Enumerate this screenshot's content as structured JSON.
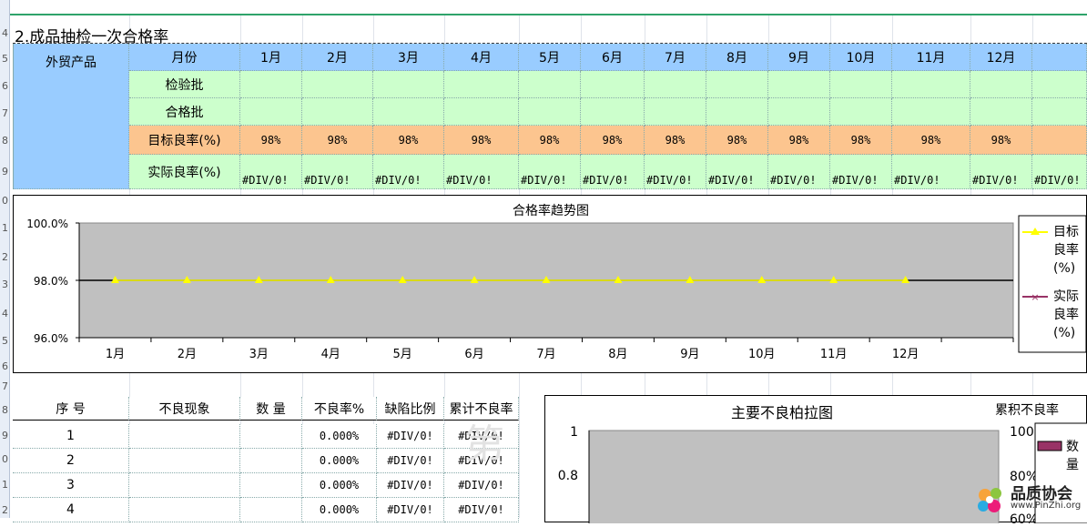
{
  "section_title": "2.成品抽检一次合格率",
  "table1": {
    "category": "外贸产品",
    "month_header": "月份",
    "months": [
      "1月",
      "2月",
      "3月",
      "4月",
      "5月",
      "6月",
      "7月",
      "8月",
      "9月",
      "10月",
      "11月",
      "12月"
    ],
    "row_labels": [
      "检验批",
      "合格批",
      "目标良率(%)",
      "实际良率(%)"
    ],
    "target_values": [
      "98%",
      "98%",
      "98%",
      "98%",
      "98%",
      "98%",
      "98%",
      "98%",
      "98%",
      "98%",
      "98%",
      "98%"
    ],
    "actual_values": [
      "#DIV/0!",
      "#DIV/0!",
      "#DIV/0!",
      "#DIV/0!",
      "#DIV/0!",
      "#DIV/0!",
      "#DIV/0!",
      "#DIV/0!",
      "#DIV/0!",
      "#DIV/0!",
      "#DIV/0!",
      "#DIV/0!",
      "#DIV/0!"
    ]
  },
  "chart_data": [
    {
      "type": "line",
      "title": "合格率趋势图",
      "categories": [
        "1月",
        "2月",
        "3月",
        "4月",
        "5月",
        "6月",
        "7月",
        "8月",
        "9月",
        "10月",
        "11月",
        "12月"
      ],
      "series": [
        {
          "name": "目标良率(%)",
          "values": [
            98,
            98,
            98,
            98,
            98,
            98,
            98,
            98,
            98,
            98,
            98,
            98
          ],
          "color": "#ffff00",
          "marker": "triangle"
        },
        {
          "name": "实际良率(%)",
          "values": [],
          "color": "#993366",
          "marker": "x"
        }
      ],
      "y_ticks": [
        "100.0%",
        "98.0%",
        "96.0%"
      ],
      "ylim": [
        96,
        100
      ],
      "legend": "right"
    },
    {
      "type": "bar",
      "title": "主要不良柏拉图",
      "y_ticks": [
        "1",
        "0.8"
      ],
      "y2_label": "累积不良率",
      "y2_ticks": [
        "100",
        "80%",
        "60%"
      ],
      "series": [
        {
          "name": "数量",
          "values": [],
          "color": "#993366"
        }
      ],
      "legend": "right"
    }
  ],
  "table2": {
    "headers": [
      "序 号",
      "不良现象",
      "数 量",
      "不良率%",
      "缺陷比例",
      "累计不良率"
    ],
    "rows": [
      [
        "1",
        "",
        "",
        "0.000%",
        "#DIV/0!",
        "#DIV/0!"
      ],
      [
        "2",
        "",
        "",
        "0.000%",
        "#DIV/0!",
        "#DIV/0!"
      ],
      [
        "3",
        "",
        "",
        "0.000%",
        "#DIV/0!",
        "#DIV/0!"
      ],
      [
        "4",
        "",
        "",
        "0.000%",
        "#DIV/0!",
        "#DIV/0!"
      ]
    ]
  },
  "row_numbers": [
    "4",
    "5",
    "6",
    "7",
    "8",
    "9",
    "0",
    "1",
    "2",
    "3",
    "4",
    "5",
    "6",
    "7",
    "8",
    "9",
    "0",
    "1",
    "2"
  ],
  "watermark_logo": {
    "name": "品质协会",
    "url": "www.PinZhi.org"
  },
  "colors": {
    "header_blue": "#99ccff",
    "cell_green": "#ccffcc",
    "target_orange": "#fcc58f",
    "plot_gray": "#c0c0c0"
  }
}
